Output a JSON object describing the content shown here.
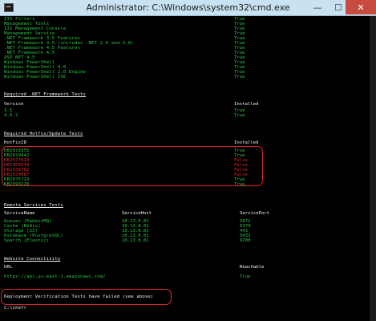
{
  "window": {
    "title": "Administrator: C:\\Windows\\system32\\cmd.exe",
    "min_label": "—",
    "max_label": "☐",
    "close_label": "✕"
  },
  "top_items": [
    {
      "name": "IIS Filters",
      "status": "True"
    },
    {
      "name": "Management Tools",
      "status": "True"
    },
    {
      "name": "IIS Management Console",
      "status": "True"
    },
    {
      "name": "Management Service",
      "status": "True"
    },
    {
      "name": ".NET Framework 3.5 Features",
      "status": "True"
    },
    {
      "name": ".NET Framework 3.5 (includes .NET 2.0 and 3.0)",
      "status": "True"
    },
    {
      "name": ".NET Framework 4.5 Features",
      "status": "True"
    },
    {
      "name": ".NET Framework 4.5",
      "status": "True"
    },
    {
      "name": "ASP.NET 4.5",
      "status": "True"
    },
    {
      "name": "Windows PowerShell",
      "status": "True"
    },
    {
      "name": "Windows PowerShell 4.0",
      "status": "True"
    },
    {
      "name": "Windows PowerShell 2.0 Engine",
      "status": "True"
    },
    {
      "name": "Windows PowerShell ISE",
      "status": "True"
    }
  ],
  "net_section": {
    "heading": "Required .NET Framework Tests",
    "col_version": "Version",
    "col_installed": "Installed",
    "rows": [
      {
        "version": "3.5",
        "installed": "True"
      },
      {
        "version": "4.5.2",
        "installed": "True"
      }
    ]
  },
  "hotfix_section": {
    "heading": "Required Hotfix/Update Tests",
    "col_id": "HotFixID",
    "col_installed": "Installed",
    "rows": [
      {
        "id": "KB2919355",
        "installed": "True",
        "ok": true
      },
      {
        "id": "KB2919442",
        "installed": "True",
        "ok": true
      },
      {
        "id": "KB2977629",
        "installed": "False",
        "ok": false
      },
      {
        "id": "KB2969339",
        "installed": "False",
        "ok": false
      },
      {
        "id": "KB2938782",
        "installed": "False",
        "ok": false
      },
      {
        "id": "KB2939087",
        "installed": "False",
        "ok": false
      },
      {
        "id": "KB2975719",
        "installed": "True",
        "ok": true
      },
      {
        "id": "KB2999226",
        "installed": "True",
        "ok": true
      }
    ]
  },
  "remote_section": {
    "heading": "Remote Services Tests",
    "col_name": "ServiceName",
    "col_host": "ServiceHost",
    "col_port": "ServicePort",
    "rows": [
      {
        "name": "Queues (RabbitMQ)",
        "host": "10.13.0.01",
        "port": "5672"
      },
      {
        "name": "Cache (Redis)",
        "host": "10.13.0.01",
        "port": "6379"
      },
      {
        "name": "Storage (S3)",
        "host": "10.13.0.01",
        "port": "443"
      },
      {
        "name": "Database (PostgreSQL)",
        "host": "10.13.0.01",
        "port": "5432"
      },
      {
        "name": "Search (Elastic)",
        "host": "10.13.0.01",
        "port": "9200"
      }
    ]
  },
  "website_section": {
    "heading": "Website Connectivity",
    "col_url": "URL",
    "col_reachable": "Reachable",
    "rows": [
      {
        "url": "https://api.us-east-1.amazonaws.com/",
        "reachable": "True"
      }
    ]
  },
  "failure_message": "Deployment Verification Tests have failed (see above)",
  "prompt": "C:\\chef>"
}
